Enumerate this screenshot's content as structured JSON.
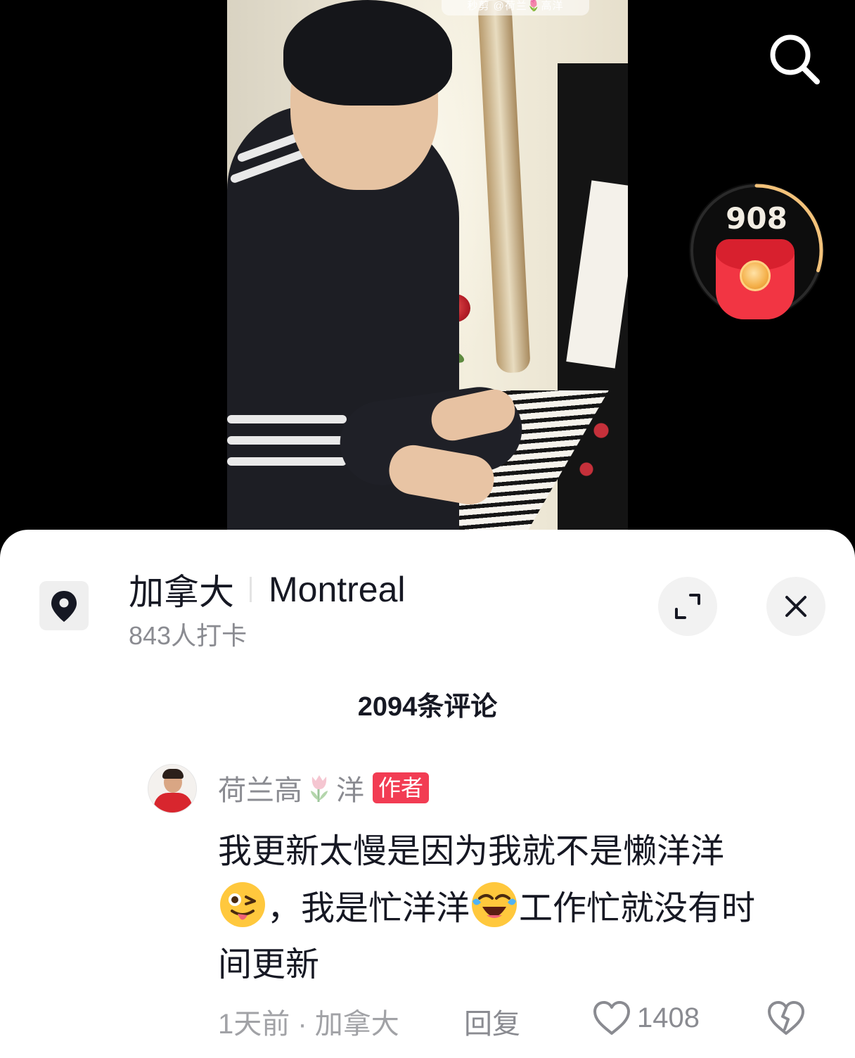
{
  "video": {
    "watermark": "秒剪 @荷兰🌷高洋"
  },
  "redpacket": {
    "count": "908",
    "progress_ring": 0.3
  },
  "location": {
    "country": "加拿大",
    "city": "Montreal",
    "checkins": "843人打卡"
  },
  "comments": {
    "count_label": "2094条评论",
    "items": [
      {
        "username_part1": "荷兰高",
        "username_part2": "洋",
        "badge": "作者",
        "text_line1": "我更新太慢是因为我就不是懒洋洋",
        "text_seg1": "，我是忙洋洋",
        "text_seg2": "工作忙就没有时",
        "text_line3": "间更新",
        "time_location": "1天前 · 加拿大",
        "reply_label": "回复",
        "likes": "1408"
      }
    ]
  },
  "icons": {
    "search": "search-icon",
    "location": "location-pin-icon",
    "expand": "expand-icon",
    "close": "close-icon",
    "like": "heart-icon",
    "dislike": "broken-heart-icon"
  },
  "colors": {
    "badge": "#f23c53",
    "redpacket": "#f23543",
    "ring": "#f3c27a"
  }
}
